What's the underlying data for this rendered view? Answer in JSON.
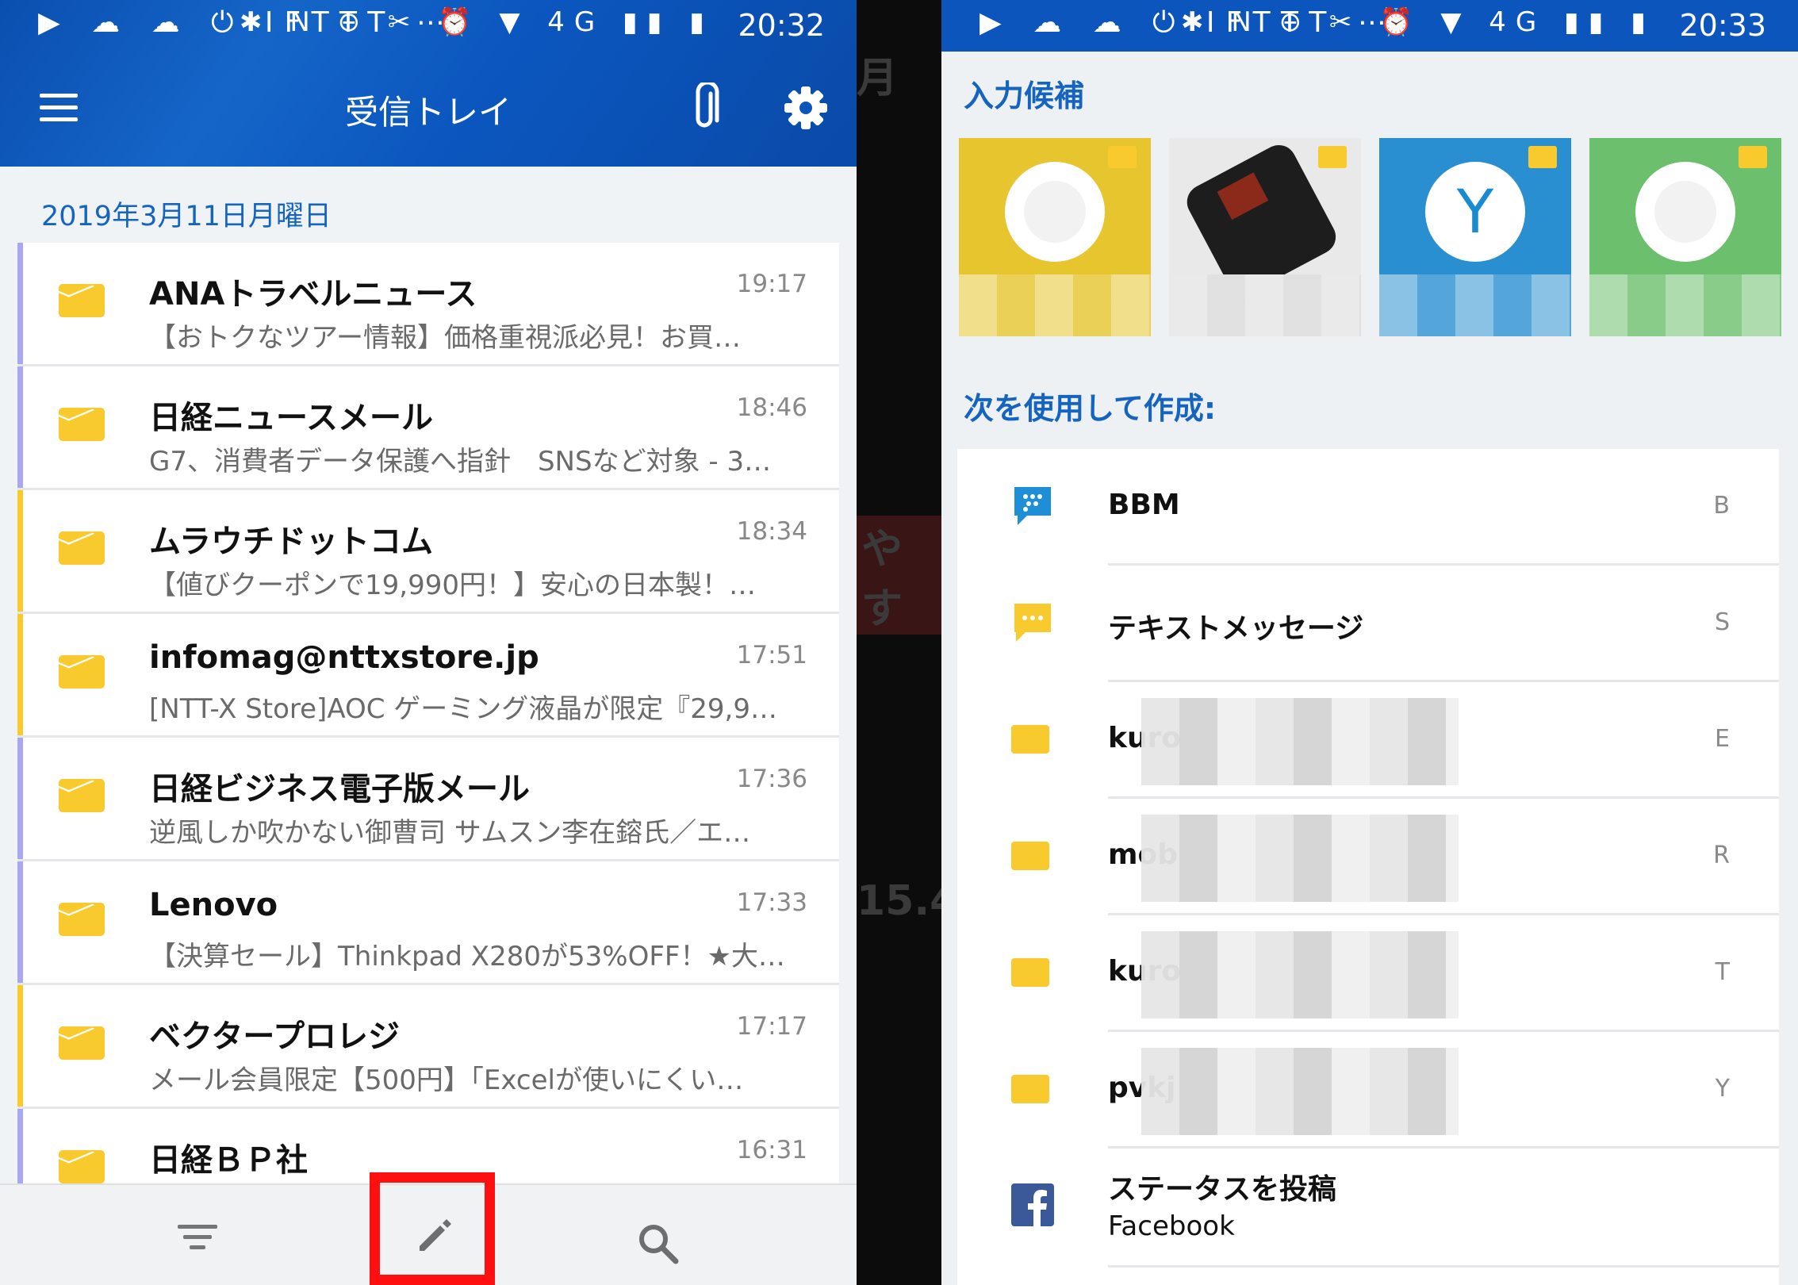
{
  "left": {
    "status": {
      "icons": "▶ ☁ ☁ ⏻ IFTTT ⋯",
      "right_icons": "✱ N ⊖ ✂ ⏰ ▼ 4G ▮▮ ▮",
      "time": "20:32"
    },
    "header": {
      "title": "受信トレイ"
    },
    "date": "2019年3月11日月曜日",
    "mails": [
      {
        "sender": "ANAトラベルニュース",
        "time": "19:17",
        "preview": "【おトクなツアー情報】価格重視派必見！お買…",
        "accent": "#a8a8f0"
      },
      {
        "sender": "日経ニュースメール",
        "time": "18:46",
        "preview": "G7、消費者データ保護へ指針　SNSなど対象 - 3…",
        "accent": "#a8a8f0"
      },
      {
        "sender": "ムラウチドットコム",
        "time": "18:34",
        "preview": "【値びクーポンで19,990円！】安心の日本製！…",
        "accent": "#f8ca2e"
      },
      {
        "sender": "infomag@nttxstore.jp",
        "time": "17:51",
        "preview": "[NTT-X Store]AOC ゲーミング液晶が限定『29,9…",
        "accent": "#f8ca2e"
      },
      {
        "sender": "日経ビジネス電子版メール",
        "time": "17:36",
        "preview": "逆風しか吹かない御曹司 サムスン李在鎔氏／エ…",
        "accent": "#a8a8f0"
      },
      {
        "sender": "Lenovo",
        "time": "17:33",
        "preview": "【決算セール】Thinkpad X280が53%OFF！★大…",
        "accent": "#a8a8f0"
      },
      {
        "sender": "ベクタープロレジ",
        "time": "17:17",
        "preview": "メール会員限定【500円】「Excelが使いにくい…",
        "accent": "#f8ca2e"
      },
      {
        "sender": "日経ＢＰ社",
        "time": "16:31",
        "preview": "",
        "accent": "#a8a8f0"
      }
    ]
  },
  "gap": {
    "frag1": "月",
    "frag2": "やす",
    "frag3": "15.4"
  },
  "right": {
    "status": {
      "icons": "▶ ☁ ☁ ⏻ IFTTT ⋯",
      "right_icons": "✱ N ⊖ ✂ ⏰ ▼ 4G ▮▮ ▮",
      "time": "20:33"
    },
    "suggest_title": "入力候補",
    "tiles": [
      {
        "color": "#e6c52e",
        "label": ""
      },
      {
        "color": "#d9d9d9",
        "label": ""
      },
      {
        "color": "#2a8fd1",
        "label": "Y"
      },
      {
        "color": "#6cbf6c",
        "label": ""
      }
    ],
    "compose_title": "次を使用して作成:",
    "apps": [
      {
        "name": "BBM",
        "key": "B",
        "icon": "bbm-icon"
      },
      {
        "name": "テキストメッセージ",
        "key": "S",
        "icon": "text-message-icon"
      },
      {
        "name": "kuro",
        "key": "E",
        "icon": "mail-icon"
      },
      {
        "name": "mob",
        "key": "R",
        "icon": "mail-icon"
      },
      {
        "name": "kuro",
        "key": "T",
        "icon": "mail-icon"
      },
      {
        "name": "pvkj",
        "key": "Y",
        "icon": "mail-icon"
      },
      {
        "name": "ステータスを投稿",
        "sub": "Facebook",
        "key": "",
        "icon": "facebook-icon"
      }
    ]
  }
}
